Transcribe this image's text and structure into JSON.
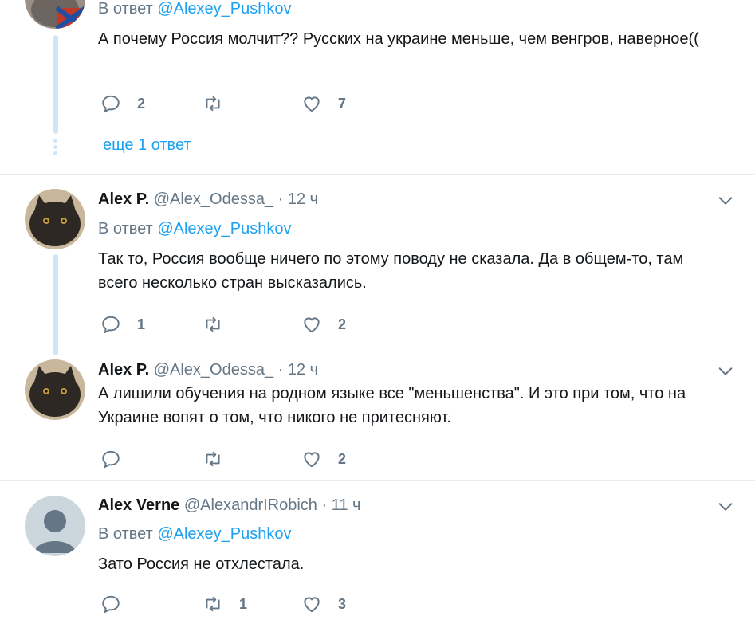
{
  "tweet0": {
    "reply_prefix": "В ответ",
    "reply_mention": "@Alexey_Pushkov",
    "text": "А почему Россия молчит?? Русских на украине меньше, чем венгров, наверное((",
    "replies": "2",
    "retweets": "",
    "likes": "7",
    "more_replies": "еще 1 ответ"
  },
  "tweet1": {
    "name": "Alex P.",
    "handle": "@Alex_Odessa_",
    "sep": "·",
    "time": "12 ч",
    "reply_prefix": "В ответ",
    "reply_mention": "@Alexey_Pushkov",
    "text": "Так то, Россия вообще ничего по этому поводу не сказала. Да в общем-то, там всего несколько стран высказались.",
    "replies": "1",
    "retweets": "",
    "likes": "2"
  },
  "tweet2": {
    "name": "Alex P.",
    "handle": "@Alex_Odessa_",
    "sep": "·",
    "time": "12 ч",
    "text": "А лишили обучения на родном языке все \"меньшенства\". И это при том, что на Украине вопят о том, что никого не притесняют.",
    "replies": "",
    "retweets": "",
    "likes": "2"
  },
  "tweet3": {
    "name": "Alex Verne",
    "handle": "@AlexandrIRobich",
    "sep": "·",
    "time": "11 ч",
    "reply_prefix": "В ответ",
    "reply_mention": "@Alexey_Pushkov",
    "text": "Зато Россия не отхлестала.",
    "replies": "",
    "retweets": "1",
    "likes": "3"
  },
  "icons": {
    "reply": "reply-icon",
    "retweet": "retweet-icon",
    "like": "heart-icon",
    "caret": "chevron-down-icon"
  },
  "colors": {
    "link": "#1da1f2",
    "muted": "#657786",
    "thread": "#cfe6f8"
  }
}
